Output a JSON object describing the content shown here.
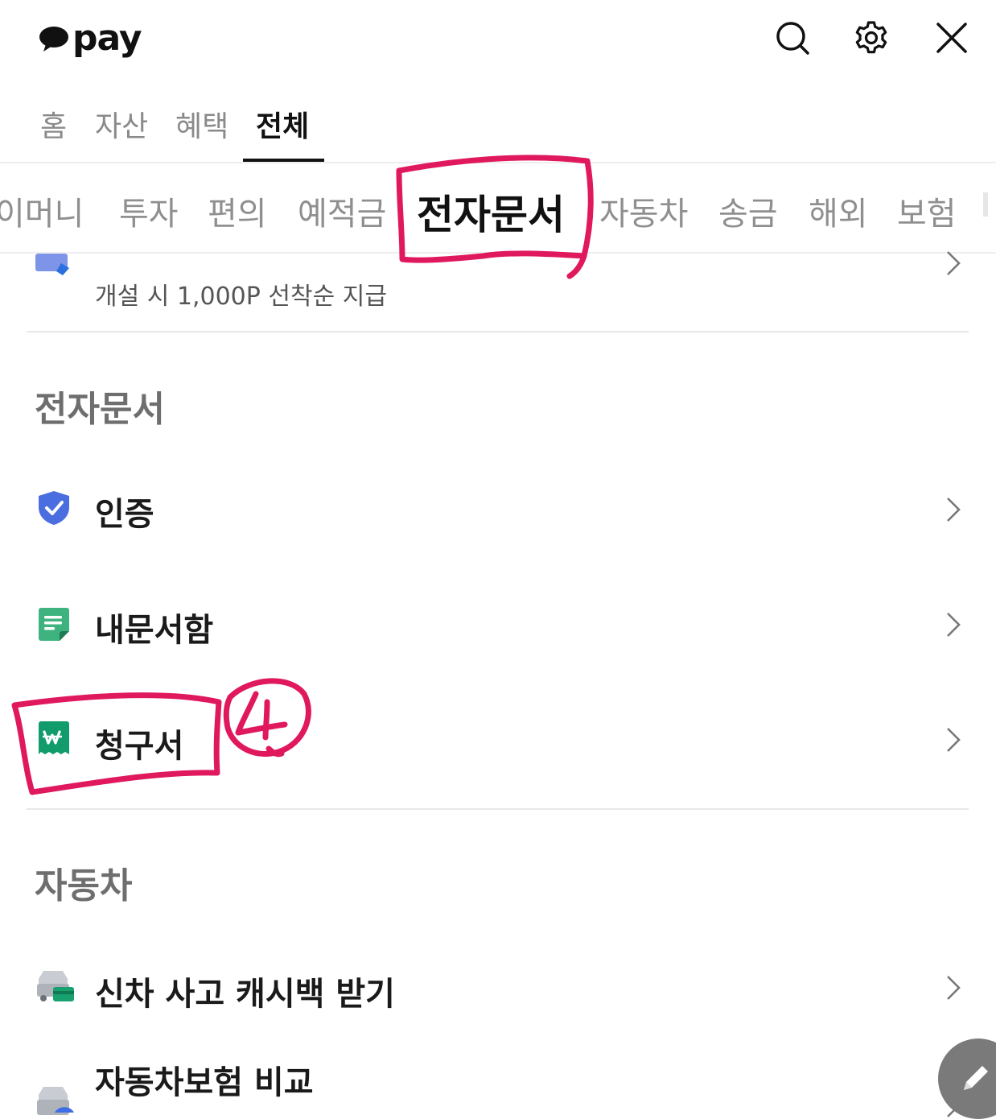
{
  "header": {
    "logo_text": "pay"
  },
  "main_tabs": [
    "홈",
    "자산",
    "혜택",
    "전체"
  ],
  "category_tabs": [
    "이머니",
    "투자",
    "편의",
    "예적금",
    "전자문서",
    "자동차",
    "송금",
    "해외",
    "보험"
  ],
  "top_item": {
    "subtitle": "개설 시 1,000P 선착순 지급"
  },
  "sections": {
    "e_document": {
      "title": "전자문서",
      "items": [
        "인증",
        "내문서함",
        "청구서"
      ]
    },
    "car": {
      "title": "자동차",
      "items": [
        "신차 사고 캐시백 받기",
        "자동차보험 비교"
      ]
    }
  },
  "annotation": {
    "step_number": "4",
    "color": "#e0195f"
  },
  "colors": {
    "shield": "#4a6ee0",
    "doc_green": "#3fb37f",
    "bill_green": "#129c6c"
  }
}
